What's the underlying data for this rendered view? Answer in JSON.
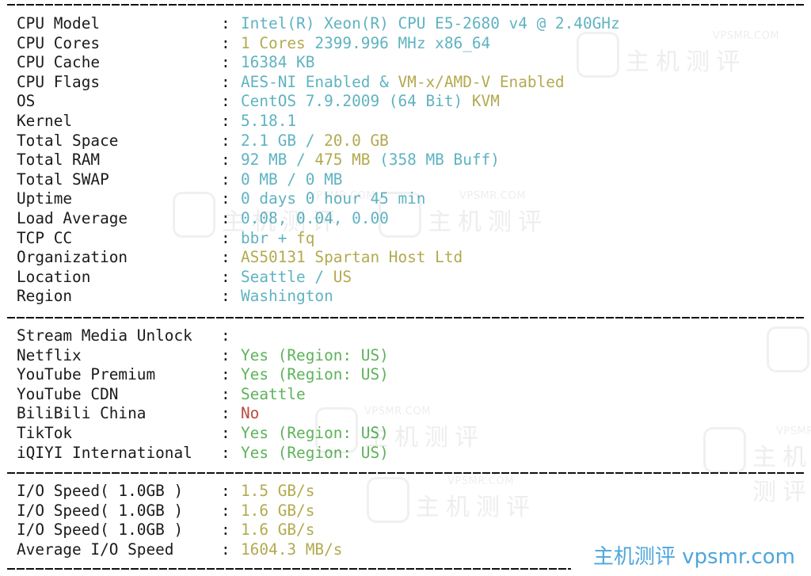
{
  "system_info": [
    {
      "label": "CPU Model",
      "parts": [
        {
          "text": "Intel(R) Xeon(R) CPU E5-2680 v4 @ 2.40GHz",
          "color": "cyan"
        }
      ]
    },
    {
      "label": "CPU Cores",
      "parts": [
        {
          "text": "1 Cores",
          "color": "yellow"
        },
        {
          "text": " 2399.996 MHz x86_64",
          "color": "cyan"
        }
      ]
    },
    {
      "label": "CPU Cache",
      "parts": [
        {
          "text": "16384 KB",
          "color": "cyan"
        }
      ]
    },
    {
      "label": "CPU Flags",
      "parts": [
        {
          "text": "AES-NI Enabled & ",
          "color": "cyan"
        },
        {
          "text": "VM-x/AMD-V Enabled",
          "color": "yellow"
        }
      ]
    },
    {
      "label": "OS",
      "parts": [
        {
          "text": "CentOS 7.9.2009 (64 Bit) ",
          "color": "cyan"
        },
        {
          "text": "KVM",
          "color": "yellow"
        }
      ]
    },
    {
      "label": "Kernel",
      "parts": [
        {
          "text": "5.18.1",
          "color": "cyan"
        }
      ]
    },
    {
      "label": "Total Space",
      "parts": [
        {
          "text": "2.1 GB / ",
          "color": "cyan"
        },
        {
          "text": "20.0 GB",
          "color": "yellow"
        }
      ]
    },
    {
      "label": "Total RAM",
      "parts": [
        {
          "text": "92 MB / ",
          "color": "cyan"
        },
        {
          "text": "475 MB",
          "color": "yellow"
        },
        {
          "text": " (358 MB Buff)",
          "color": "cyan"
        }
      ]
    },
    {
      "label": "Total SWAP",
      "parts": [
        {
          "text": "0 MB / 0 MB",
          "color": "cyan"
        }
      ]
    },
    {
      "label": "Uptime",
      "parts": [
        {
          "text": "0 days 0 hour 45 min",
          "color": "cyan"
        }
      ]
    },
    {
      "label": "Load Average",
      "parts": [
        {
          "text": "0.08, 0.04, 0.00",
          "color": "cyan"
        }
      ]
    },
    {
      "label": "TCP CC",
      "parts": [
        {
          "text": "bbr + ",
          "color": "cyan"
        },
        {
          "text": "fq",
          "color": "yellow"
        }
      ]
    },
    {
      "label": "Organization",
      "parts": [
        {
          "text": "AS50131 Spartan Host Ltd",
          "color": "yellow"
        }
      ]
    },
    {
      "label": "Location",
      "parts": [
        {
          "text": "Seattle / ",
          "color": "cyan"
        },
        {
          "text": "US",
          "color": "yellow"
        }
      ]
    },
    {
      "label": "Region",
      "parts": [
        {
          "text": "Washington",
          "color": "cyan"
        }
      ]
    }
  ],
  "stream_media": {
    "header": "Stream Media Unlock",
    "items": [
      {
        "label": "Netflix",
        "value": "Yes (Region: US)",
        "color": "green"
      },
      {
        "label": "YouTube Premium",
        "value": "Yes (Region: US)",
        "color": "green"
      },
      {
        "label": "YouTube CDN",
        "value": "Seattle",
        "color": "green"
      },
      {
        "label": "BiliBili China",
        "value": "No",
        "color": "red"
      },
      {
        "label": "TikTok",
        "value": "Yes (Region: US)",
        "color": "green"
      },
      {
        "label": "iQIYI International",
        "value": "Yes (Region: US)",
        "color": "green"
      }
    ]
  },
  "io_speed": [
    {
      "label": "I/O Speed( 1.0GB )",
      "value": "1.5 GB/s"
    },
    {
      "label": "I/O Speed( 1.0GB )",
      "value": "1.6 GB/s"
    },
    {
      "label": "I/O Speed( 1.0GB )",
      "value": "1.6 GB/s"
    },
    {
      "label": "Average I/O Speed",
      "value": "1604.3 MB/s"
    }
  ],
  "colon": ":",
  "watermark": {
    "small": "VPSMR.COM",
    "big": "主机测评"
  },
  "brand": "主机测评 vpsmr.com",
  "colors": {
    "cyan": "#5fb3c1",
    "yellow": "#b3aa4f",
    "green": "#5db35a",
    "red": "#b84b3e",
    "brand": "#4da6dd"
  }
}
